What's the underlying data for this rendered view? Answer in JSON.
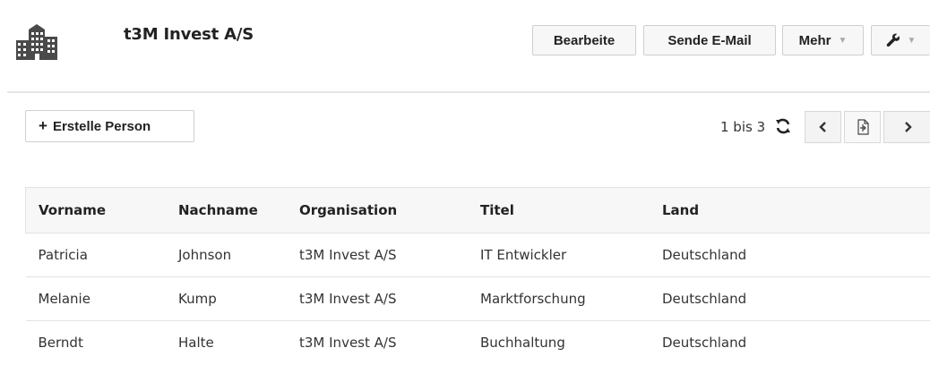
{
  "header": {
    "title": "t3M Invest A/S",
    "icon": "building-icon",
    "buttons": {
      "edit": "Bearbeite",
      "email": "Sende E-Mail",
      "more": "Mehr",
      "tools_icon": "wrench-icon"
    }
  },
  "toolbar": {
    "create_label": "Erstelle Person",
    "range": "1 bis 3",
    "refresh_icon": "refresh-icon",
    "prev_icon": "chevron-left-icon",
    "export_icon": "export-icon",
    "next_icon": "chevron-right-icon"
  },
  "table": {
    "columns": [
      "Vorname",
      "Nachname",
      "Organisation",
      "Titel",
      "Land"
    ],
    "rows": [
      [
        "Patricia",
        "Johnson",
        "t3M Invest A/S",
        "IT Entwickler",
        "Deutschland"
      ],
      [
        "Melanie",
        "Kump",
        "t3M Invest A/S",
        "Marktforschung",
        "Deutschland"
      ],
      [
        "Berndt",
        "Halte",
        "t3M Invest A/S",
        "Buchhaltung",
        "Deutschland"
      ]
    ]
  }
}
